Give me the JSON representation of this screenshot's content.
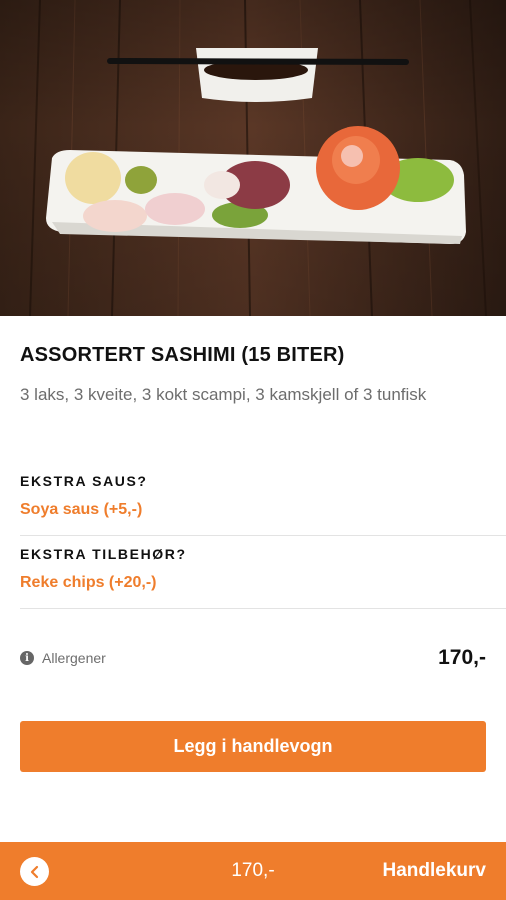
{
  "product": {
    "title": "ASSORTERT SASHIMI (15 BITER)",
    "description": "3 laks, 3 kveite, 3 kokt scampi, 3 kamskjell of 3 tunfisk",
    "image_icon": "sashimi-plate-photo"
  },
  "options": [
    {
      "heading": "EKSTRA SAUS?",
      "selected": "Soya saus (+5,-)"
    },
    {
      "heading": "EKSTRA TILBEHØR?",
      "selected": "Reke chips (+20,-)"
    }
  ],
  "allergen": {
    "icon": "info-icon",
    "label": "Allergener"
  },
  "price": "170,-",
  "add_button": {
    "label": "Legg i handlevogn"
  },
  "bottom_bar": {
    "back_icon": "chevron-left-icon",
    "total": "170,-",
    "cart_label": "Handlekurv"
  },
  "colors": {
    "accent": "#ef7d2c",
    "text": "#111111",
    "muted": "#6d6d6d"
  }
}
